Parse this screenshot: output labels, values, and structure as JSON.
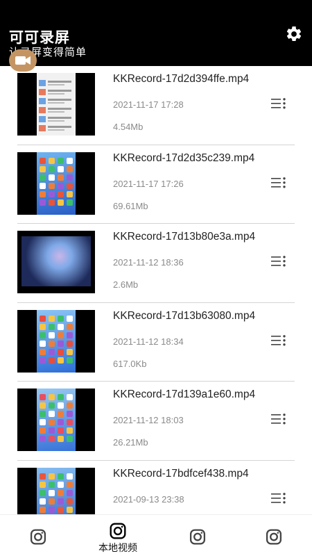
{
  "header": {
    "title": "可可录屏",
    "subtitle": "让录屏变得简单",
    "settings_icon": "gear-icon",
    "record_icon": "video-camera-icon",
    "accent": "#c49563"
  },
  "videos": [
    {
      "name": "KKRecord-17d2d394ffe.mp4",
      "date": "2021-11-17 17:28",
      "size": "4.54Mb",
      "thumb": "app-list",
      "palette": [
        "#f1f1f1",
        "#e45b3a",
        "#4a8ee0"
      ]
    },
    {
      "name": "KKRecord-17d2d35c239.mp4",
      "date": "2021-11-17 17:26",
      "size": "69.61Mb",
      "thumb": "home-screen",
      "palette": [
        "#2a5fc6",
        "#6fb4f0",
        "#e8553a"
      ]
    },
    {
      "name": "KKRecord-17d13b80e3a.mp4",
      "date": "2021-11-12 18:36",
      "size": "2.6Mb",
      "thumb": "game",
      "palette": [
        "#1e2a5a",
        "#7fa9e8",
        "#c9b6e8"
      ]
    },
    {
      "name": "KKRecord-17d13b63080.mp4",
      "date": "2021-11-12 18:34",
      "size": "617.0Kb",
      "thumb": "home-screen",
      "palette": [
        "#2f6fd6",
        "#8cc4f5",
        "#e84d3d"
      ]
    },
    {
      "name": "KKRecord-17d139a1e60.mp4",
      "date": "2021-11-12 18:03",
      "size": "26.21Mb",
      "thumb": "home-screen",
      "palette": [
        "#3773d8",
        "#96c8f2",
        "#e94f5f"
      ]
    },
    {
      "name": "KKRecord-17bdfcef438.mp4",
      "date": "2021-09-13 23:38",
      "size": "",
      "thumb": "home-screen",
      "palette": [
        "#2d68cc",
        "#86bdf0",
        "#e7573e"
      ]
    }
  ],
  "bottom_nav": [
    {
      "label": "",
      "icon": "instagram-camera-icon",
      "active": false
    },
    {
      "label": "本地视频",
      "icon": "instagram-camera-icon",
      "active": true
    },
    {
      "label": "",
      "icon": "instagram-camera-icon",
      "active": false
    },
    {
      "label": "",
      "icon": "instagram-camera-icon",
      "active": false
    }
  ],
  "colors": {
    "header_bg": "#000000",
    "divider": "#d4d4d4",
    "meta_text": "#8a8a8a"
  }
}
